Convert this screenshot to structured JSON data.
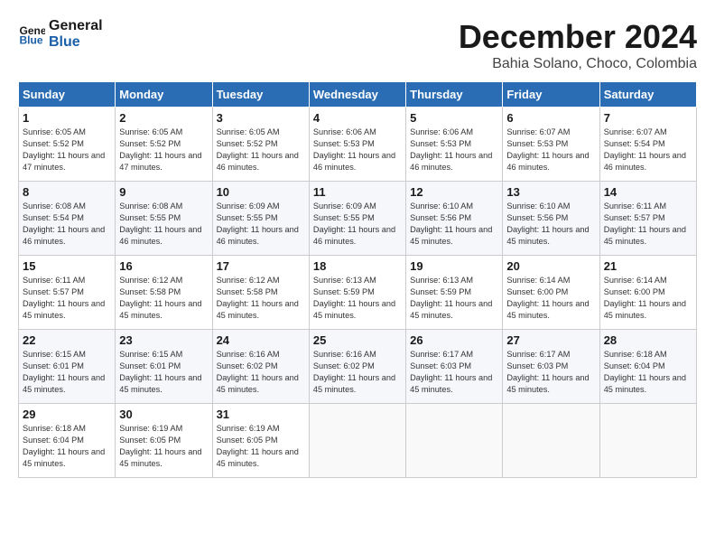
{
  "logo": {
    "text_general": "General",
    "text_blue": "Blue"
  },
  "header": {
    "month": "December 2024",
    "location": "Bahia Solano, Choco, Colombia"
  },
  "weekdays": [
    "Sunday",
    "Monday",
    "Tuesday",
    "Wednesday",
    "Thursday",
    "Friday",
    "Saturday"
  ],
  "weeks": [
    [
      {
        "day": "1",
        "sunrise": "6:05 AM",
        "sunset": "5:52 PM",
        "daylight": "11 hours and 47 minutes."
      },
      {
        "day": "2",
        "sunrise": "6:05 AM",
        "sunset": "5:52 PM",
        "daylight": "11 hours and 47 minutes."
      },
      {
        "day": "3",
        "sunrise": "6:05 AM",
        "sunset": "5:52 PM",
        "daylight": "11 hours and 46 minutes."
      },
      {
        "day": "4",
        "sunrise": "6:06 AM",
        "sunset": "5:53 PM",
        "daylight": "11 hours and 46 minutes."
      },
      {
        "day": "5",
        "sunrise": "6:06 AM",
        "sunset": "5:53 PM",
        "daylight": "11 hours and 46 minutes."
      },
      {
        "day": "6",
        "sunrise": "6:07 AM",
        "sunset": "5:53 PM",
        "daylight": "11 hours and 46 minutes."
      },
      {
        "day": "7",
        "sunrise": "6:07 AM",
        "sunset": "5:54 PM",
        "daylight": "11 hours and 46 minutes."
      }
    ],
    [
      {
        "day": "8",
        "sunrise": "6:08 AM",
        "sunset": "5:54 PM",
        "daylight": "11 hours and 46 minutes."
      },
      {
        "day": "9",
        "sunrise": "6:08 AM",
        "sunset": "5:55 PM",
        "daylight": "11 hours and 46 minutes."
      },
      {
        "day": "10",
        "sunrise": "6:09 AM",
        "sunset": "5:55 PM",
        "daylight": "11 hours and 46 minutes."
      },
      {
        "day": "11",
        "sunrise": "6:09 AM",
        "sunset": "5:55 PM",
        "daylight": "11 hours and 46 minutes."
      },
      {
        "day": "12",
        "sunrise": "6:10 AM",
        "sunset": "5:56 PM",
        "daylight": "11 hours and 45 minutes."
      },
      {
        "day": "13",
        "sunrise": "6:10 AM",
        "sunset": "5:56 PM",
        "daylight": "11 hours and 45 minutes."
      },
      {
        "day": "14",
        "sunrise": "6:11 AM",
        "sunset": "5:57 PM",
        "daylight": "11 hours and 45 minutes."
      }
    ],
    [
      {
        "day": "15",
        "sunrise": "6:11 AM",
        "sunset": "5:57 PM",
        "daylight": "11 hours and 45 minutes."
      },
      {
        "day": "16",
        "sunrise": "6:12 AM",
        "sunset": "5:58 PM",
        "daylight": "11 hours and 45 minutes."
      },
      {
        "day": "17",
        "sunrise": "6:12 AM",
        "sunset": "5:58 PM",
        "daylight": "11 hours and 45 minutes."
      },
      {
        "day": "18",
        "sunrise": "6:13 AM",
        "sunset": "5:59 PM",
        "daylight": "11 hours and 45 minutes."
      },
      {
        "day": "19",
        "sunrise": "6:13 AM",
        "sunset": "5:59 PM",
        "daylight": "11 hours and 45 minutes."
      },
      {
        "day": "20",
        "sunrise": "6:14 AM",
        "sunset": "6:00 PM",
        "daylight": "11 hours and 45 minutes."
      },
      {
        "day": "21",
        "sunrise": "6:14 AM",
        "sunset": "6:00 PM",
        "daylight": "11 hours and 45 minutes."
      }
    ],
    [
      {
        "day": "22",
        "sunrise": "6:15 AM",
        "sunset": "6:01 PM",
        "daylight": "11 hours and 45 minutes."
      },
      {
        "day": "23",
        "sunrise": "6:15 AM",
        "sunset": "6:01 PM",
        "daylight": "11 hours and 45 minutes."
      },
      {
        "day": "24",
        "sunrise": "6:16 AM",
        "sunset": "6:02 PM",
        "daylight": "11 hours and 45 minutes."
      },
      {
        "day": "25",
        "sunrise": "6:16 AM",
        "sunset": "6:02 PM",
        "daylight": "11 hours and 45 minutes."
      },
      {
        "day": "26",
        "sunrise": "6:17 AM",
        "sunset": "6:03 PM",
        "daylight": "11 hours and 45 minutes."
      },
      {
        "day": "27",
        "sunrise": "6:17 AM",
        "sunset": "6:03 PM",
        "daylight": "11 hours and 45 minutes."
      },
      {
        "day": "28",
        "sunrise": "6:18 AM",
        "sunset": "6:04 PM",
        "daylight": "11 hours and 45 minutes."
      }
    ],
    [
      {
        "day": "29",
        "sunrise": "6:18 AM",
        "sunset": "6:04 PM",
        "daylight": "11 hours and 45 minutes."
      },
      {
        "day": "30",
        "sunrise": "6:19 AM",
        "sunset": "6:05 PM",
        "daylight": "11 hours and 45 minutes."
      },
      {
        "day": "31",
        "sunrise": "6:19 AM",
        "sunset": "6:05 PM",
        "daylight": "11 hours and 45 minutes."
      },
      null,
      null,
      null,
      null
    ]
  ],
  "labels": {
    "sunrise": "Sunrise: ",
    "sunset": "Sunset: ",
    "daylight": "Daylight: "
  }
}
